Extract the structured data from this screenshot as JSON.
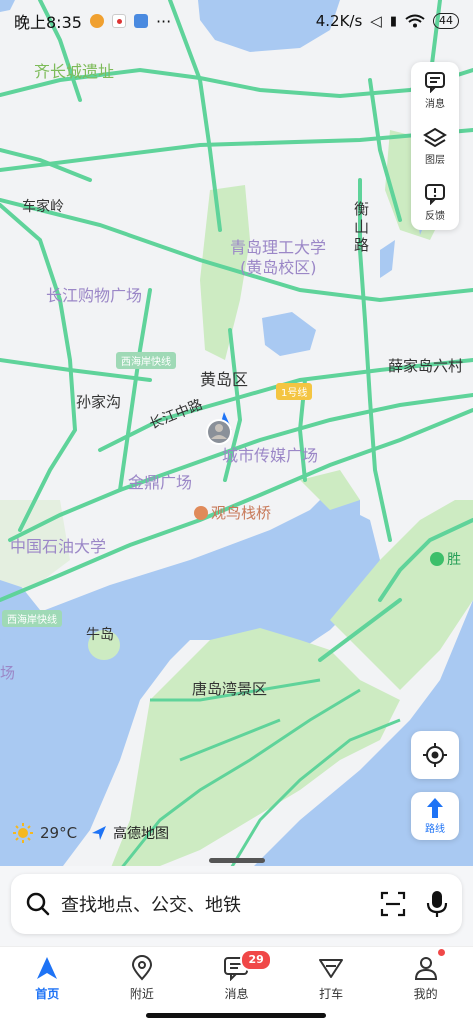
{
  "status_bar": {
    "time": "晚上8:35",
    "more": "···",
    "network_speed": "4.2K/s",
    "battery": "44"
  },
  "map_labels": {
    "qichangcheng": "齐长城遗址",
    "chejialing": "车家岭",
    "university": "青岛理工大学",
    "university_campus": "(黄岛校区)",
    "hengshan_road": "衡山路",
    "changjiang_mall": "长江购物广场",
    "huangdao_district": "黄岛区",
    "xuejiadao": "薛家岛六村",
    "sunjiagou": "孙家沟",
    "changjiang_road": "长江中路",
    "media_plaza": "城市传媒广场",
    "jinding": "金鼎广场",
    "guanniao": "观鸟栈桥",
    "petroleum_univ": "中国石油大学",
    "niudao": "牛岛",
    "tangdao": "唐岛湾景区",
    "field": "场",
    "sheng": "胜",
    "west_coast_expressway_a": "西海岸快线",
    "west_coast_expressway_b": "西海岸快线",
    "metro_line_1": "1号线"
  },
  "tools": {
    "messages": "消息",
    "layers": "图层",
    "feedback": "反馈"
  },
  "route_button": "路线",
  "weather": {
    "temperature": "29°C",
    "brand": "高德地图"
  },
  "search": {
    "placeholder": "查找地点、公交、地铁"
  },
  "bottom_nav": {
    "home": "首页",
    "nearby": "附近",
    "messages": "消息",
    "messages_badge": "29",
    "taxi": "打车",
    "profile": "我的"
  },
  "colors": {
    "water": "#a9c9f2",
    "land": "#f2f3f5",
    "green_area": "#cdebc2",
    "road": "#5fd39a",
    "accent": "#1e73f5",
    "badge": "#f04848"
  }
}
